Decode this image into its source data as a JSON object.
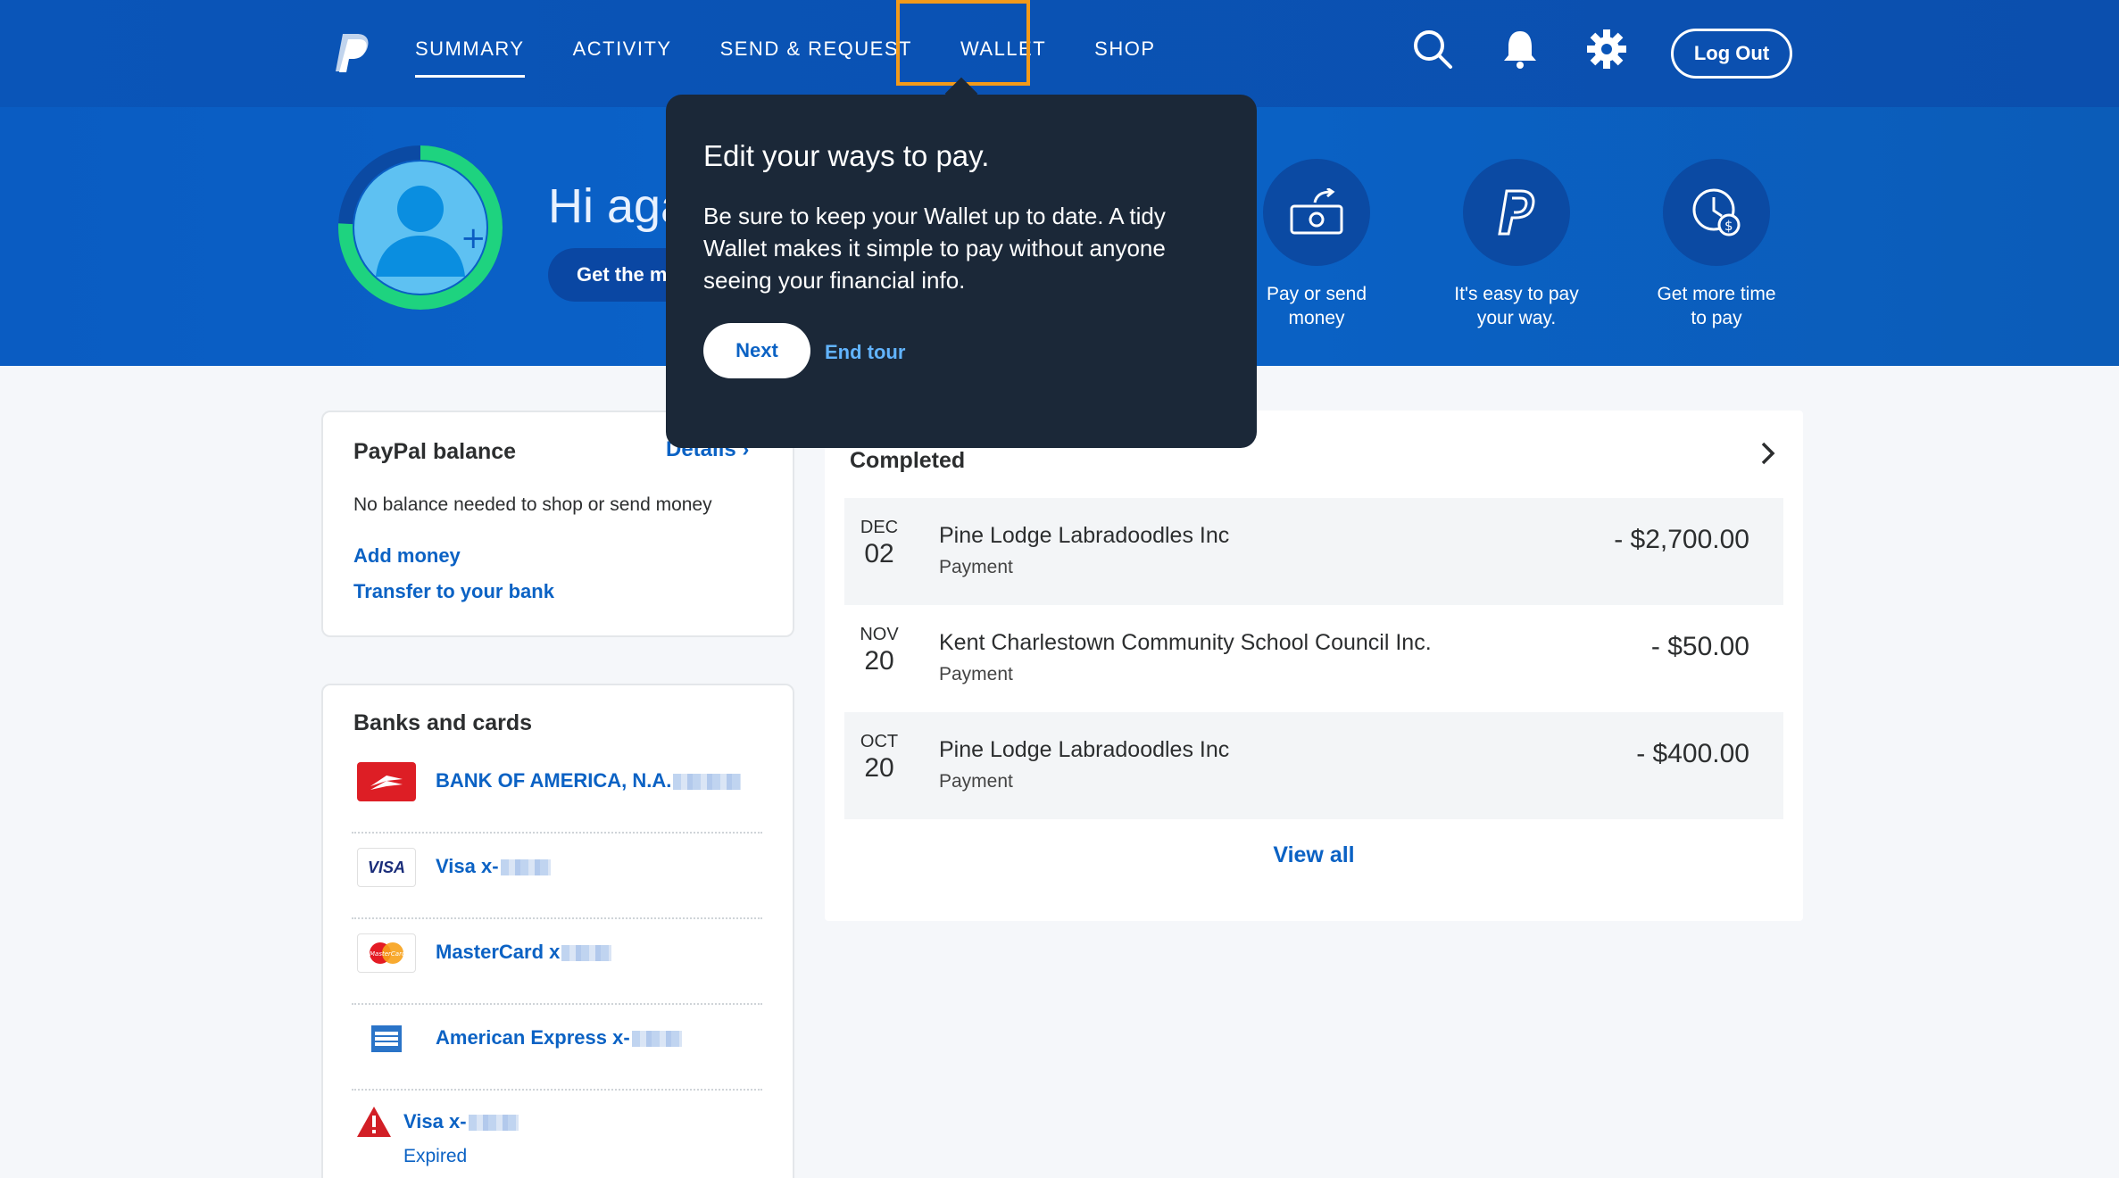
{
  "nav": {
    "items": [
      "SUMMARY",
      "ACTIVITY",
      "SEND & REQUEST",
      "WALLET",
      "SHOP"
    ],
    "active": "SUMMARY",
    "highlighted": "WALLET"
  },
  "header": {
    "logout_label": "Log Out",
    "icons": [
      "search-icon",
      "bell-icon",
      "gear-icon"
    ]
  },
  "hero": {
    "greeting": "Hi aga",
    "get_more_label": "Get the m",
    "quick_actions": [
      {
        "label_line1": "Pay or send",
        "label_line2": "money",
        "icon": "money-send-icon"
      },
      {
        "label_line1": "It's easy to pay",
        "label_line2": "your way.",
        "icon": "paypal-p-icon"
      },
      {
        "label_line1": "Get more time",
        "label_line2": "to pay",
        "icon": "clock-dollar-icon"
      }
    ]
  },
  "tooltip": {
    "title": "Edit your ways to pay.",
    "body": "Be sure to keep your Wallet up to date. A tidy Wallet makes it simple to pay without anyone seeing your financial info.",
    "next_label": "Next",
    "end_label": "End tour"
  },
  "balance": {
    "title": "PayPal balance",
    "details_label": "Details",
    "subtitle": "No balance needed to shop or send money",
    "add_money": "Add money",
    "transfer": "Transfer to your bank"
  },
  "banks": {
    "title": "Banks and cards",
    "items": [
      {
        "name": "BANK OF AMERICA, N.A.",
        "logo": "bank-of-america-logo"
      },
      {
        "name": "Visa x-",
        "logo": "visa-logo",
        "logo_text": "VISA"
      },
      {
        "name": "MasterCard x",
        "logo": "mastercard-logo",
        "logo_text": "MasterCard"
      },
      {
        "name": "American Express x-",
        "logo": "amex-logo"
      },
      {
        "name": "Visa x-",
        "logo": "warning-icon",
        "status": "Expired"
      }
    ]
  },
  "activity": {
    "section_title": "Completed",
    "view_all": "View all",
    "transactions": [
      {
        "month": "DEC",
        "day": "02",
        "name": "Pine Lodge Labradoodles Inc",
        "type": "Payment",
        "amount": "- $2,700.00"
      },
      {
        "month": "NOV",
        "day": "20",
        "name": "Kent Charlestown Community School Council Inc.",
        "type": "Payment",
        "amount": "- $50.00"
      },
      {
        "month": "OCT",
        "day": "20",
        "name": "Pine Lodge Labradoodles Inc",
        "type": "Payment",
        "amount": "- $400.00"
      }
    ]
  },
  "colors": {
    "brand_blue": "#0a5cc2",
    "link_blue": "#0b62c4",
    "tooltip_bg": "#1b2838",
    "highlight_orange": "#f39a1a",
    "avatar_ring": "#1ed37f"
  }
}
